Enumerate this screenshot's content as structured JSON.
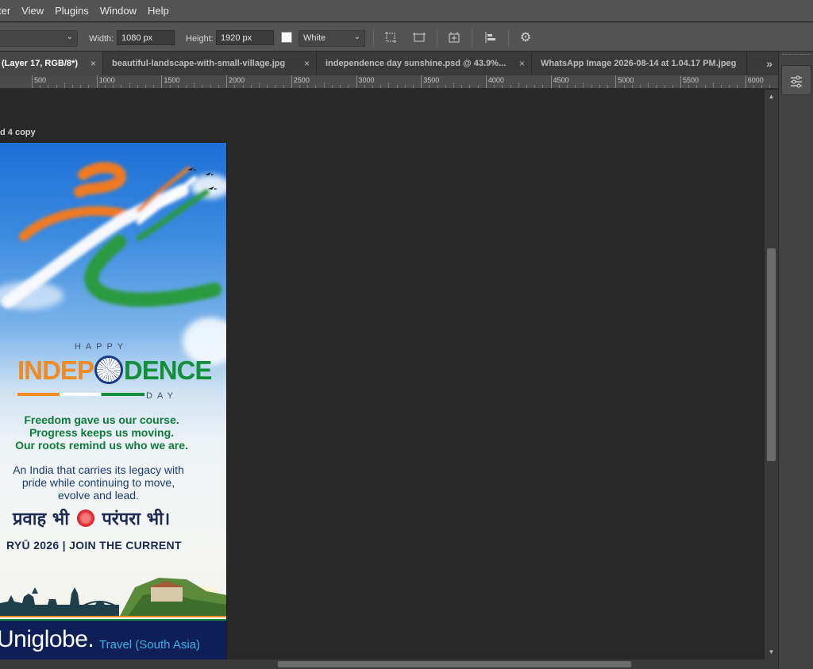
{
  "menu": [
    "ter",
    "View",
    "Plugins",
    "Window",
    "Help"
  ],
  "options": {
    "width_label": "Width:",
    "width_value": "1080 px",
    "height_label": "Height:",
    "height_value": "1920 px",
    "fill_value": "White"
  },
  "tabs": [
    {
      "label": "(Layer 17, RGB/8*)",
      "close": "×"
    },
    {
      "label": "beautiful-landscape-with-small-village.jpg",
      "close": "×"
    },
    {
      "label": "independence day sunshine.psd @ 43.9%...",
      "close": "×"
    },
    {
      "label": "WhatsApp Image 2026-08-14 at 1.04.17 PM.jpeg",
      "close": ""
    }
  ],
  "tab_overflow": "»",
  "ruler": [
    "500",
    "1000",
    "1500",
    "2000",
    "2500",
    "3000",
    "3500",
    "4000",
    "4500",
    "5000",
    "5500",
    "6000"
  ],
  "layer_label": "d 4 copy",
  "artwork": {
    "happy": "HAPPY",
    "inde_left": "INDEP",
    "inde_right": "DENCE",
    "day": "DAY",
    "line1": "Freedom gave us our course.",
    "line2": "Progress keeps us moving.",
    "line3": "Our roots remind us who we are.",
    "line4": "An India that carries its legacy with",
    "line5": "pride while continuing to move,",
    "line6": "evolve and lead.",
    "hindi_left": "प्रवाह भी",
    "hindi_right": "परंपरा भी।",
    "tagline": "RYŪ 2026 | JOIN THE CURRENT",
    "brand": "Uniglobe.",
    "brand_sub": "Travel (South Asia)"
  },
  "colors": {
    "saffron": "#f08a24",
    "green": "#138f3b",
    "navy": "#0e1f57",
    "brand_blue": "#38b4e8"
  }
}
